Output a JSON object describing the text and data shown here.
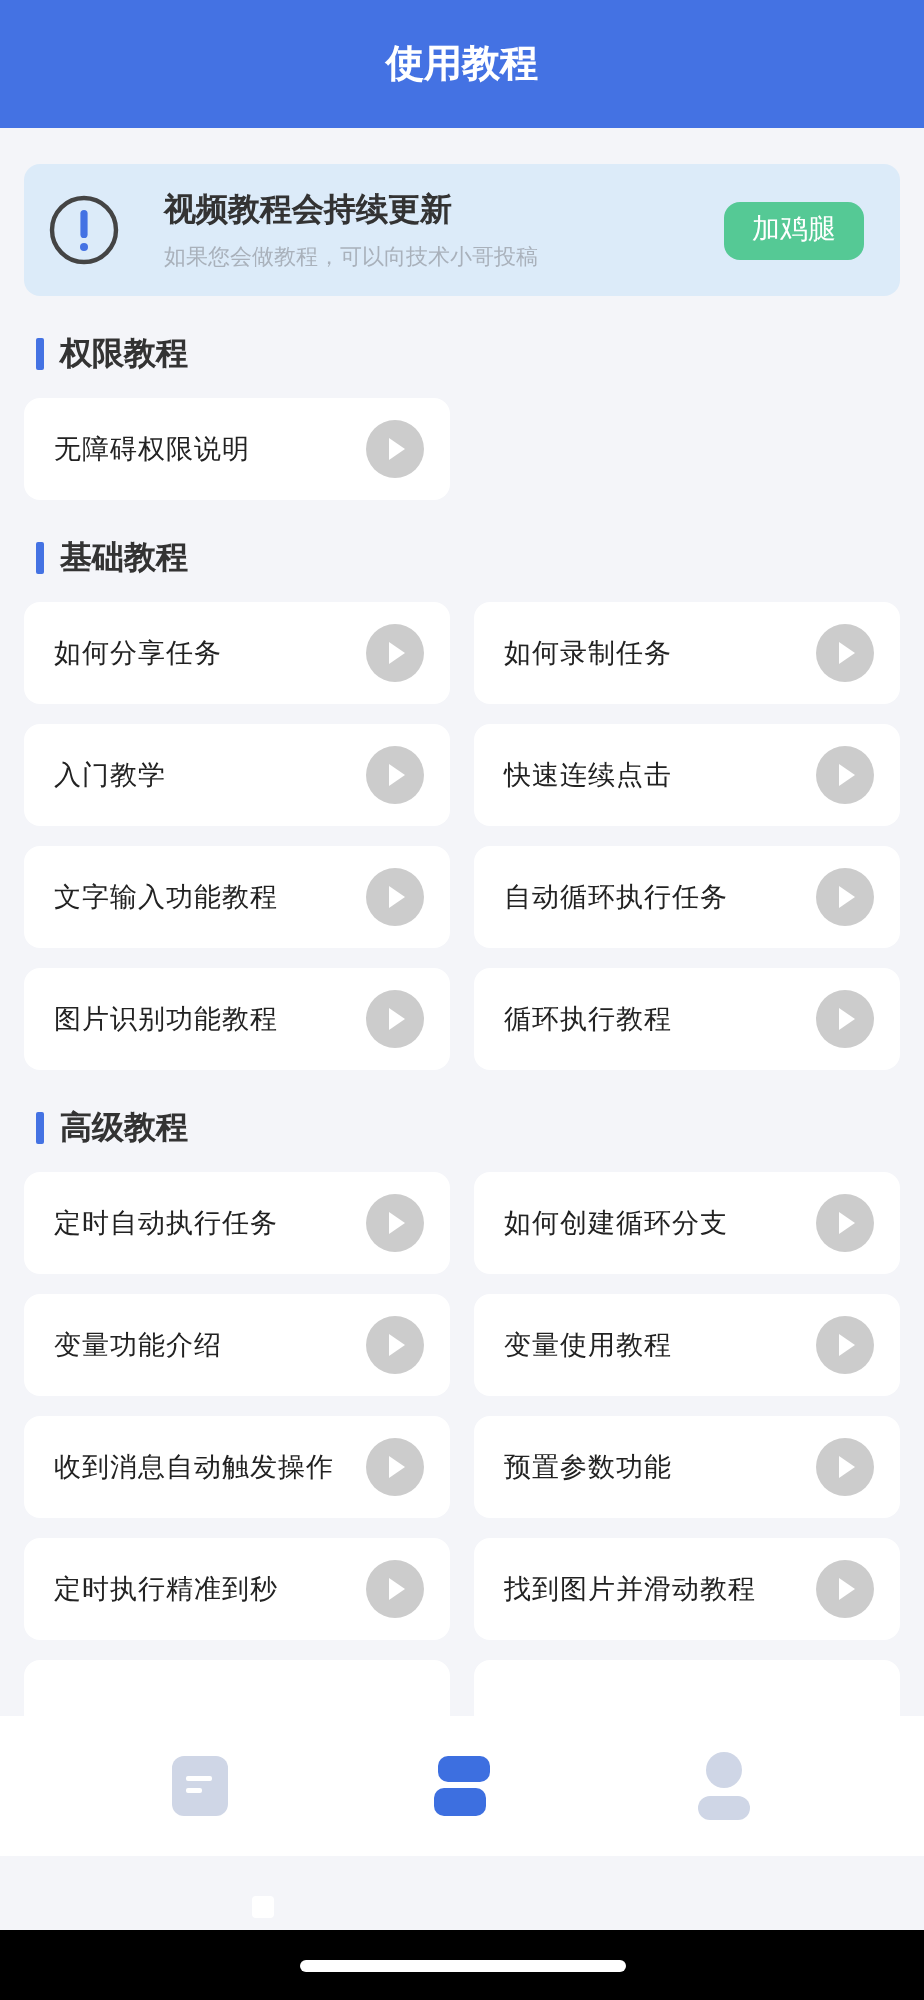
{
  "header": {
    "title": "使用教程"
  },
  "banner": {
    "title": "视频教程会持续更新",
    "subtitle": "如果您会做教程，可以向技术小哥投稿",
    "button": "加鸡腿"
  },
  "sections": [
    {
      "title": "权限教程",
      "items": [
        "无障碍权限说明"
      ]
    },
    {
      "title": "基础教程",
      "items": [
        "如何分享任务",
        "如何录制任务",
        "入门教学",
        "快速连续点击",
        "文字输入功能教程",
        "自动循环执行任务",
        "图片识别功能教程",
        "循环执行教程"
      ]
    },
    {
      "title": "高级教程",
      "items": [
        "定时自动执行任务",
        "如何创建循环分支",
        "变量功能介绍",
        "变量使用教程",
        "收到消息自动触发操作",
        "预置参数功能",
        "定时执行精准到秒",
        "找到图片并滑动教程"
      ],
      "cut_off": [
        {
          "kind": "card"
        },
        {
          "kind": "card"
        }
      ]
    }
  ],
  "tab_bar": [
    {
      "kind": "document",
      "selected": false
    },
    {
      "kind": "tutorial",
      "selected": true
    },
    {
      "kind": "profile",
      "selected": false
    }
  ]
}
